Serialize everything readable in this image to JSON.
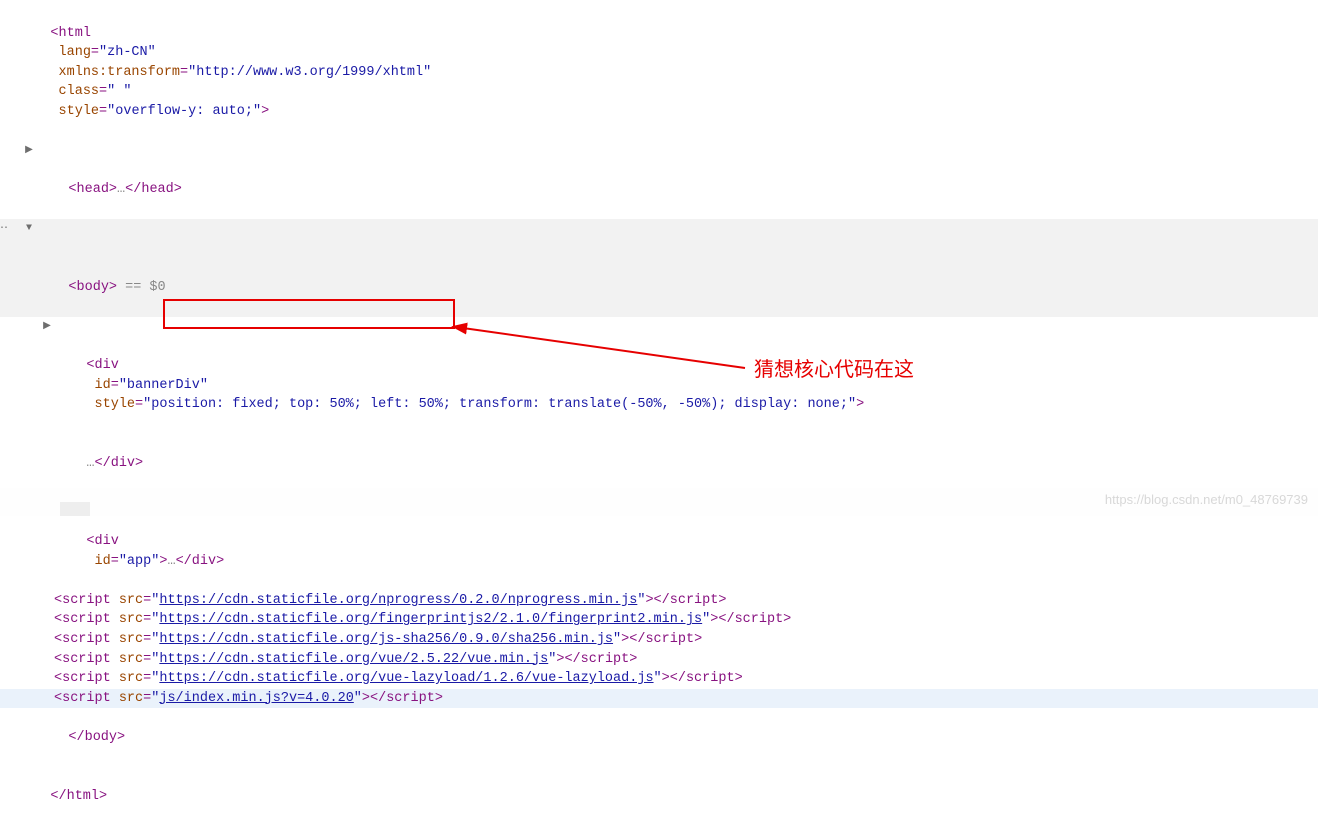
{
  "html_open": {
    "tag": "html",
    "lang_attr": "lang",
    "lang_val": "\"zh-CN\"",
    "xmlns_attr": "xmlns:transform",
    "xmlns_val": "\"http://www.w3.org/1999/xhtml\"",
    "class_attr": "class",
    "class_val": "\" \"",
    "style_attr": "style",
    "style_val": "\"overflow-y: auto;\""
  },
  "head": {
    "tag": "head",
    "ellipsis": "…"
  },
  "body_open": {
    "tag": "body",
    "eq_marker": " == $0"
  },
  "banner": {
    "tag": "div",
    "id_attr": "id",
    "id_val": "\"bannerDiv\"",
    "style_attr": "style",
    "style_val": "\"position: fixed; top: 50%; left: 50%; transform: translate(-50%, -50%); display: none;\"",
    "ellipsis": "…"
  },
  "app": {
    "tag": "div",
    "id_attr": "id",
    "id_val": "\"app\"",
    "ellipsis": "…"
  },
  "scripts": [
    {
      "tag": "script",
      "src_attr": "src",
      "url": "https://cdn.staticfile.org/nprogress/0.2.0/nprogress.min.js"
    },
    {
      "tag": "script",
      "src_attr": "src",
      "url": "https://cdn.staticfile.org/fingerprintjs2/2.1.0/fingerprint2.min.js"
    },
    {
      "tag": "script",
      "src_attr": "src",
      "url": "https://cdn.staticfile.org/js-sha256/0.9.0/sha256.min.js"
    },
    {
      "tag": "script",
      "src_attr": "src",
      "url": "https://cdn.staticfile.org/vue/2.5.22/vue.min.js"
    },
    {
      "tag": "script",
      "src_attr": "src",
      "url": "https://cdn.staticfile.org/vue-lazyload/1.2.6/vue-lazyload.js"
    },
    {
      "tag": "script",
      "src_attr": "src",
      "url": "js/index.min.js?v=4.0.20"
    }
  ],
  "body_close": "body",
  "html_close": "html",
  "annotation": "猜想核心代码在这",
  "watermark": "https://blog.csdn.net/m0_48769739"
}
